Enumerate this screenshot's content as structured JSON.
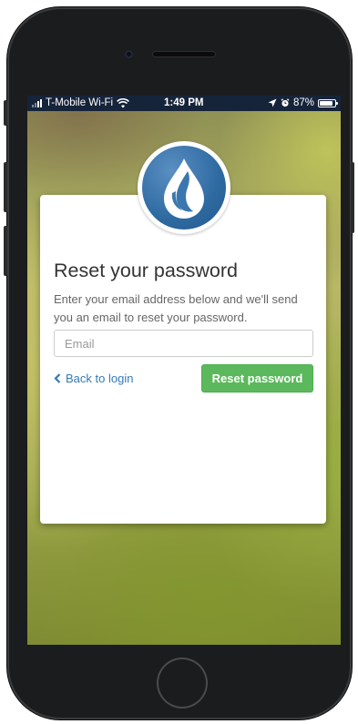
{
  "status_bar": {
    "carrier": "T-Mobile Wi-Fi",
    "time": "1:49 PM",
    "battery_percent": "87%",
    "battery_level": 0.87,
    "icons": [
      "signal-icon",
      "wifi-icon",
      "location-arrow-icon",
      "alarm-icon",
      "battery-icon"
    ]
  },
  "logo": {
    "icon": "water-drop-leaf-icon",
    "color": "#2e6aa1"
  },
  "reset_form": {
    "title": "Reset your password",
    "description": "Enter your email address below and we'll send you an email to reset your password.",
    "email": {
      "placeholder": "Email",
      "value": ""
    },
    "back_link": "Back to login",
    "submit_label": "Reset password"
  },
  "colors": {
    "accent_link": "#337ab7",
    "button_green": "#5cb85c",
    "status_bar_bg": "#16243a"
  }
}
